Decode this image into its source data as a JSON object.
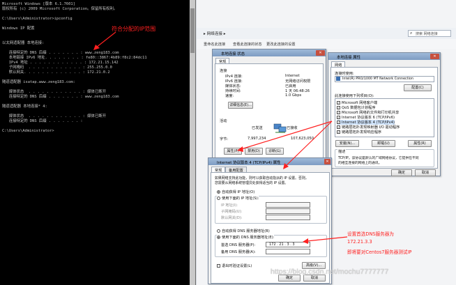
{
  "console": {
    "lines": [
      "Microsoft Windows [版本 6.1.7601]",
      "版权所有 (c) 2009 Microsoft Corporation。保留所有权利。",
      "",
      "C:\\Users\\Administrator>ipconfig",
      "",
      "Windows IP 配置",
      "",
      "",
      "以太网适配器 本地连接:",
      "",
      "   连接特定的 DNS 后缀 . . . . . . . : www.zeng183.com",
      "   本地链接 IPv6 地址. . . . . . . . : fe80::3867:4b89:f8c2:84dc11",
      "   IPv4 地址 . . . . . . . . . . . . : 172.21.15.142",
      "   子网掩码  . . . . . . . . . . . . : 255.255.0.0",
      "   默认网关. . . . . . . . . . . . . : 172.21.0.2",
      "",
      "隧道适配器 isatap.www.zeng183.com:",
      "",
      "   媒体状态  . . . . . . . . . . . . : 媒体已断开",
      "   连接特定的 DNS 后缀 . . . . . . . : www.zeng183.com",
      "",
      "隧道适配器 本地连接* 4:",
      "",
      "   媒体状态  . . . . . . . . . . . . : 媒体已断开",
      "   连接特定的 DNS 后缀 . . . . . . . :",
      "",
      "C:\\Users\\Administrator>"
    ]
  },
  "annotations": {
    "ip_range_note": "符合分配的IP范围",
    "dns_note_1": "设置首选DNS服务器为",
    "dns_note_2": "172.21.3.3",
    "dns_note_3": "即将要对Centos7服务器测试IP"
  },
  "explorer": {
    "breadcrumb": "▸ 网络连接 ▸",
    "search_placeholder": "搜索 网络连接",
    "cmd_items": [
      "重命名此连接",
      "查看此连接的状态",
      "更改此连接的设置"
    ]
  },
  "status_window": {
    "title": "本地连接 状态",
    "tab": "常规",
    "section_connection": "连接",
    "rows": [
      {
        "label": "IPv4 连接:",
        "value": "Internet"
      },
      {
        "label": "IPv6 连接:",
        "value": "无网络访问权限"
      },
      {
        "label": "媒体状态:",
        "value": "已启用"
      },
      {
        "label": "持续时间:",
        "value": "1 天 06:48:26"
      },
      {
        "label": "速度:",
        "value": "1.0 Gbps"
      }
    ],
    "details_button": "详细信息(E)...",
    "section_activity": "活动",
    "sent_label": "已发送",
    "received_label": "已接收",
    "bytes_label": "字节:",
    "sent_bytes": "7,997,234",
    "received_bytes": "107,623,050",
    "properties_button": "属性(P)",
    "disable_button": "禁用(D)",
    "diagnose_button": "诊断(G)"
  },
  "props_window": {
    "title": "本地连接 属性",
    "tab": "网络",
    "connect_using_label": "连接时使用:",
    "adapter": "Intel(R) PRO/1000 MT Network Connection",
    "configure_button": "配置(C)",
    "items_label": "此连接使用下列项目(O):",
    "items": [
      "Microsoft 网络客户端",
      "QoS 数据包计划程序",
      "Microsoft 网络的文件和打印机共享",
      "Internet 协议版本 6 (TCP/IPv6)",
      "Internet 协议版本 4 (TCP/IPv4)",
      "链路层拓扑发现映射器 I/O 驱动程序",
      "链路层拓扑发现响应程序"
    ],
    "install_button": "安装(N)...",
    "uninstall_button": "卸载(U)",
    "properties_button": "属性(R)",
    "desc_label": "描述",
    "desc_text_1": "TCP/IP。该协议是默认的广域网络协议，它提供在不同",
    "desc_text_2": "的相互连接的网络上的通讯。",
    "ok_button": "确定",
    "cancel_button": "取消"
  },
  "ipv4_window": {
    "title": "Internet 协议版本 4 (TCP/IPv4) 属性",
    "tabs": [
      "常规",
      "备用配置"
    ],
    "intro_1": "如果网络支持此功能，则可以获取自动指派的 IP 设置。否则，",
    "intro_2": "您需要从网络系统管理员处获得适当的 IP 设置。",
    "auto_ip": "自动获得 IP 地址(O)",
    "manual_ip": "使用下面的 IP 地址(S):",
    "ip_label": "IP 地址(I):",
    "mask_label": "子网掩码(U):",
    "gateway_label": "默认网关(D):",
    "auto_dns": "自动获得 DNS 服务器地址(B)",
    "manual_dns": "使用下面的 DNS 服务器地址(E):",
    "preferred_dns_label": "首选 DNS 服务器(P):",
    "preferred_dns_value": "172 . 21 . 3 . 3",
    "alternate_dns_label": "备用 DNS 服务器(A):",
    "validate_label": "退出时验证设置(L)",
    "advanced_button": "高级(V)...",
    "ok_button": "确定",
    "cancel_button": "取消"
  },
  "watermark": "https://blog.csdn.net/mochu7777777",
  "colors": {
    "annotation": "#ff2020",
    "console_bg": "#000000",
    "titlebar": "#9fb9d8"
  }
}
